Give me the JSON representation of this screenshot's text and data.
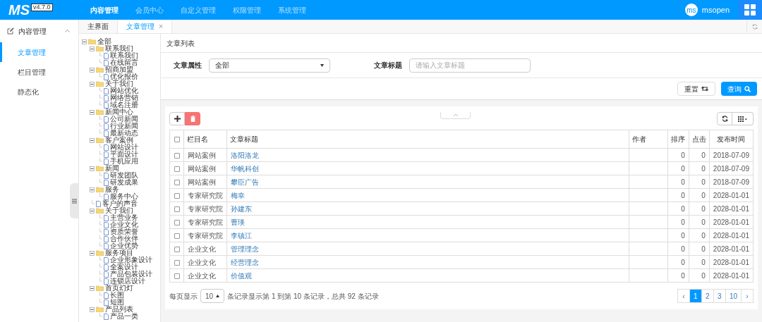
{
  "logo": {
    "text": "MS",
    "version": "v4.7.0"
  },
  "top_nav": [
    {
      "label": "内容管理",
      "selected": true
    },
    {
      "label": "会员中心",
      "selected": false
    },
    {
      "label": "自定义管理",
      "selected": false
    },
    {
      "label": "权限管理",
      "selected": false
    },
    {
      "label": "系统管理",
      "selected": false
    }
  ],
  "user": {
    "avatar": "ms",
    "name": "msopen"
  },
  "sidebar": {
    "group": {
      "label": "内容管理",
      "expanded": true
    },
    "items": [
      {
        "label": "文章管理",
        "selected": true
      },
      {
        "label": "栏目管理",
        "selected": false
      },
      {
        "label": "静态化",
        "selected": false
      }
    ]
  },
  "tabs": [
    {
      "label": "主界面",
      "selected": false
    },
    {
      "label": "文章管理",
      "selected": true,
      "close": "×"
    }
  ],
  "tree": [
    {
      "label": "全部",
      "kind": "folder",
      "children": [
        {
          "label": "联系我们",
          "kind": "folder",
          "children": [
            {
              "label": "联系我们",
              "kind": "doc"
            },
            {
              "label": "在线留言",
              "kind": "doc"
            }
          ]
        },
        {
          "label": "招商加盟",
          "kind": "folder",
          "children": [
            {
              "label": "优化报价",
              "kind": "doc"
            }
          ]
        },
        {
          "label": "关于我们",
          "kind": "folder",
          "children": [
            {
              "label": "网站优化",
              "kind": "doc"
            },
            {
              "label": "网络营销",
              "kind": "doc"
            },
            {
              "label": "域名注册",
              "kind": "doc"
            }
          ]
        },
        {
          "label": "新闻中心",
          "kind": "folder",
          "children": [
            {
              "label": "公司新闻",
              "kind": "doc"
            },
            {
              "label": "行业新闻",
              "kind": "doc"
            },
            {
              "label": "最新动态",
              "kind": "doc"
            }
          ]
        },
        {
          "label": "客户案例",
          "kind": "folder",
          "children": [
            {
              "label": "网站设计",
              "kind": "doc"
            },
            {
              "label": "平面设计",
              "kind": "doc"
            },
            {
              "label": "手机应用",
              "kind": "doc"
            }
          ]
        },
        {
          "label": "新闻",
          "kind": "folder",
          "children": [
            {
              "label": "研发团队",
              "kind": "doc"
            },
            {
              "label": "研发成果",
              "kind": "doc"
            }
          ]
        },
        {
          "label": "服务",
          "kind": "folder",
          "children": [
            {
              "label": "服务中心",
              "kind": "doc"
            }
          ]
        },
        {
          "label": "客户的声音",
          "kind": "doc"
        },
        {
          "label": "关于我们",
          "kind": "folder",
          "children": [
            {
              "label": "主营业务",
              "kind": "doc"
            },
            {
              "label": "企业文化",
              "kind": "doc"
            },
            {
              "label": "资质荣誉",
              "kind": "doc"
            },
            {
              "label": "合作伙伴",
              "kind": "doc"
            },
            {
              "label": "企业优势",
              "kind": "doc"
            }
          ]
        },
        {
          "label": "服务项目",
          "kind": "folder",
          "children": [
            {
              "label": "企业形象设计",
              "kind": "doc"
            },
            {
              "label": "全案设计",
              "kind": "doc"
            },
            {
              "label": "产品包装设计",
              "kind": "doc"
            },
            {
              "label": "连锁店设计",
              "kind": "doc"
            }
          ]
        },
        {
          "label": "首页幻灯",
          "kind": "folder",
          "children": [
            {
              "label": "长图",
              "kind": "doc"
            },
            {
              "label": "短图",
              "kind": "doc"
            }
          ]
        },
        {
          "label": "产品列表",
          "kind": "folder",
          "children": [
            {
              "label": "产品一类",
              "kind": "doc"
            }
          ]
        }
      ]
    }
  ],
  "panel": {
    "title": "文章列表",
    "filters": [
      {
        "label": "文章属性",
        "kind": "select",
        "value": "全部"
      },
      {
        "label": "文章标题",
        "kind": "input",
        "placeholder": "请输入文章标题"
      }
    ],
    "buttons": [
      {
        "label": "重置",
        "kind": "default"
      },
      {
        "label": "查询",
        "kind": "primary"
      }
    ]
  },
  "table": {
    "all_checked": false,
    "columns": [
      "栏目名",
      "文章标题",
      "作者",
      "排序",
      "点击",
      "发布时间"
    ],
    "rows": [
      {
        "checked": false,
        "cells": [
          "网站案例",
          "洛阳洛龙",
          "",
          "0",
          "0",
          "2018-07-09"
        ]
      },
      {
        "checked": false,
        "cells": [
          "网站案例",
          "华帆科创",
          "",
          "0",
          "0",
          "2018-07-09"
        ]
      },
      {
        "checked": false,
        "cells": [
          "网站案例",
          "攀臣广告",
          "",
          "0",
          "0",
          "2018-07-09"
        ]
      },
      {
        "checked": false,
        "cells": [
          "专家研究院",
          "梅幸",
          "",
          "0",
          "0",
          "2028-01-01"
        ]
      },
      {
        "checked": false,
        "cells": [
          "专家研究院",
          "孙建东",
          "",
          "0",
          "0",
          "2028-01-01"
        ]
      },
      {
        "checked": false,
        "cells": [
          "专家研究院",
          "曹瑛",
          "",
          "0",
          "0",
          "2028-01-01"
        ]
      },
      {
        "checked": false,
        "cells": [
          "专家研究院",
          "李镇江",
          "",
          "0",
          "0",
          "2028-01-01"
        ]
      },
      {
        "checked": false,
        "cells": [
          "企业文化",
          "管理理念",
          "",
          "0",
          "0",
          "2028-01-01"
        ]
      },
      {
        "checked": false,
        "cells": [
          "企业文化",
          "经营理念",
          "",
          "0",
          "0",
          "2028-01-01"
        ]
      },
      {
        "checked": false,
        "cells": [
          "企业文化",
          "价值观",
          "",
          "0",
          "0",
          "2028-01-01"
        ]
      }
    ]
  },
  "pagination": {
    "per_page_label": "每页显示",
    "per_page": "10",
    "summary": "条记录显示第 1 到第 10 条记录，总共 92 条记录",
    "pages": [
      {
        "label": "‹",
        "selected": false
      },
      {
        "label": "1",
        "selected": true
      },
      {
        "label": "2",
        "selected": false
      },
      {
        "label": "3",
        "selected": false
      },
      {
        "label": "10",
        "selected": false
      },
      {
        "label": "›",
        "selected": false
      }
    ]
  }
}
